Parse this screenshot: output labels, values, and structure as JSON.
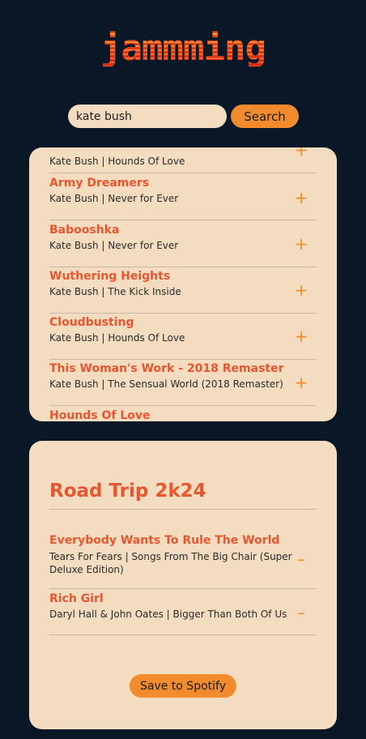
{
  "app": {
    "logo": "jammming"
  },
  "search": {
    "value": "kate bush",
    "button_label": "Search"
  },
  "results": {
    "tracks": [
      {
        "title": "",
        "meta": "Kate Bush | Hounds Of Love",
        "action": "+"
      },
      {
        "title": "Army Dreamers",
        "meta": "Kate Bush | Never for Ever",
        "action": "+"
      },
      {
        "title": "Babooshka",
        "meta": "Kate Bush | Never for Ever",
        "action": "+"
      },
      {
        "title": "Wuthering Heights",
        "meta": "Kate Bush | The Kick Inside",
        "action": "+"
      },
      {
        "title": "Cloudbusting",
        "meta": "Kate Bush | Hounds Of Love",
        "action": "+"
      },
      {
        "title": "This Woman's Work - 2018 Remaster",
        "meta": "Kate Bush | The Sensual World (2018 Remaster)",
        "action": "+"
      },
      {
        "title": "Hounds Of Love",
        "meta": "",
        "action": ""
      }
    ]
  },
  "playlist": {
    "name": "Road Trip 2k24",
    "tracks": [
      {
        "title": "Everybody Wants To Rule The World",
        "meta": "Tears For Fears | Songs From The Big Chair (Super Deluxe Edition)",
        "action": "–"
      },
      {
        "title": "Rich Girl",
        "meta": "Daryl Hall & John Oates | Bigger Than Both Of Us",
        "action": "–"
      }
    ],
    "save_label": "Save to Spotify"
  }
}
